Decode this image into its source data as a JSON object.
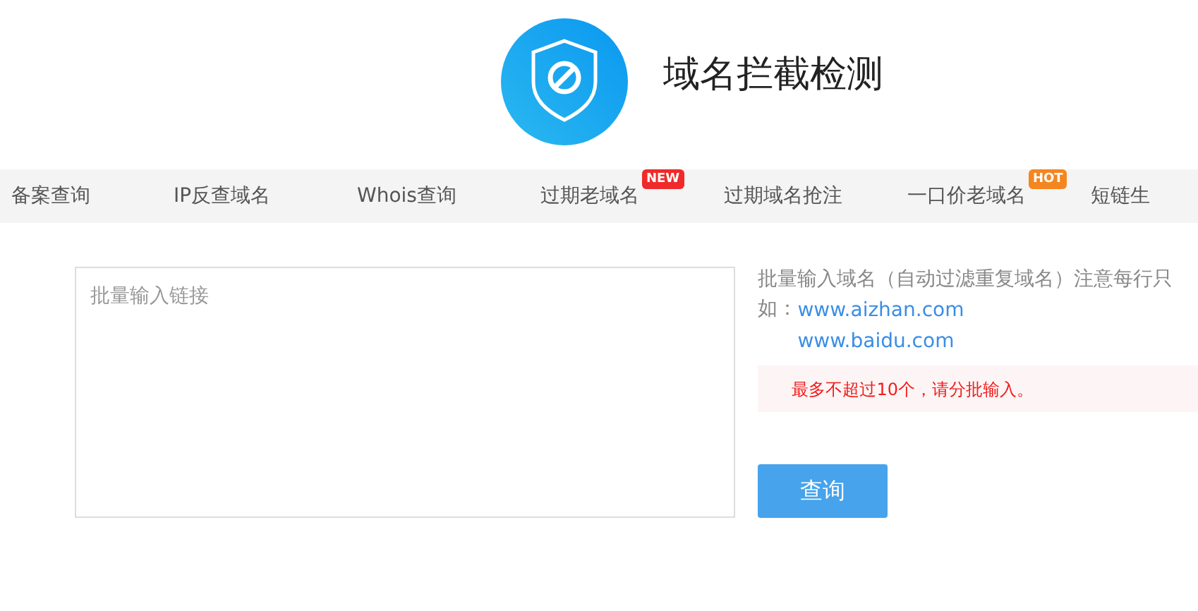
{
  "header": {
    "title": "域名拦截检测"
  },
  "nav": [
    {
      "label": "备案查询"
    },
    {
      "label": "IP反查域名"
    },
    {
      "label": "Whois查询"
    },
    {
      "label": "过期老域名",
      "badge": {
        "text": "NEW",
        "color": "#f02a2a"
      }
    },
    {
      "label": "过期域名抢注"
    },
    {
      "label": "一口价老域名",
      "badge": {
        "text": "HOT",
        "color": "#f5861f"
      }
    },
    {
      "label": "短链生"
    }
  ],
  "form": {
    "input": {
      "placeholder": "批量输入链接"
    },
    "hint": "批量输入域名（自动过滤重复域名）注意每行只",
    "example_label": "如：",
    "examples": [
      "www.aizhan.com",
      "www.baidu.com"
    ],
    "alert": "最多不超过10个，请分批输入。",
    "submit": "查询"
  }
}
